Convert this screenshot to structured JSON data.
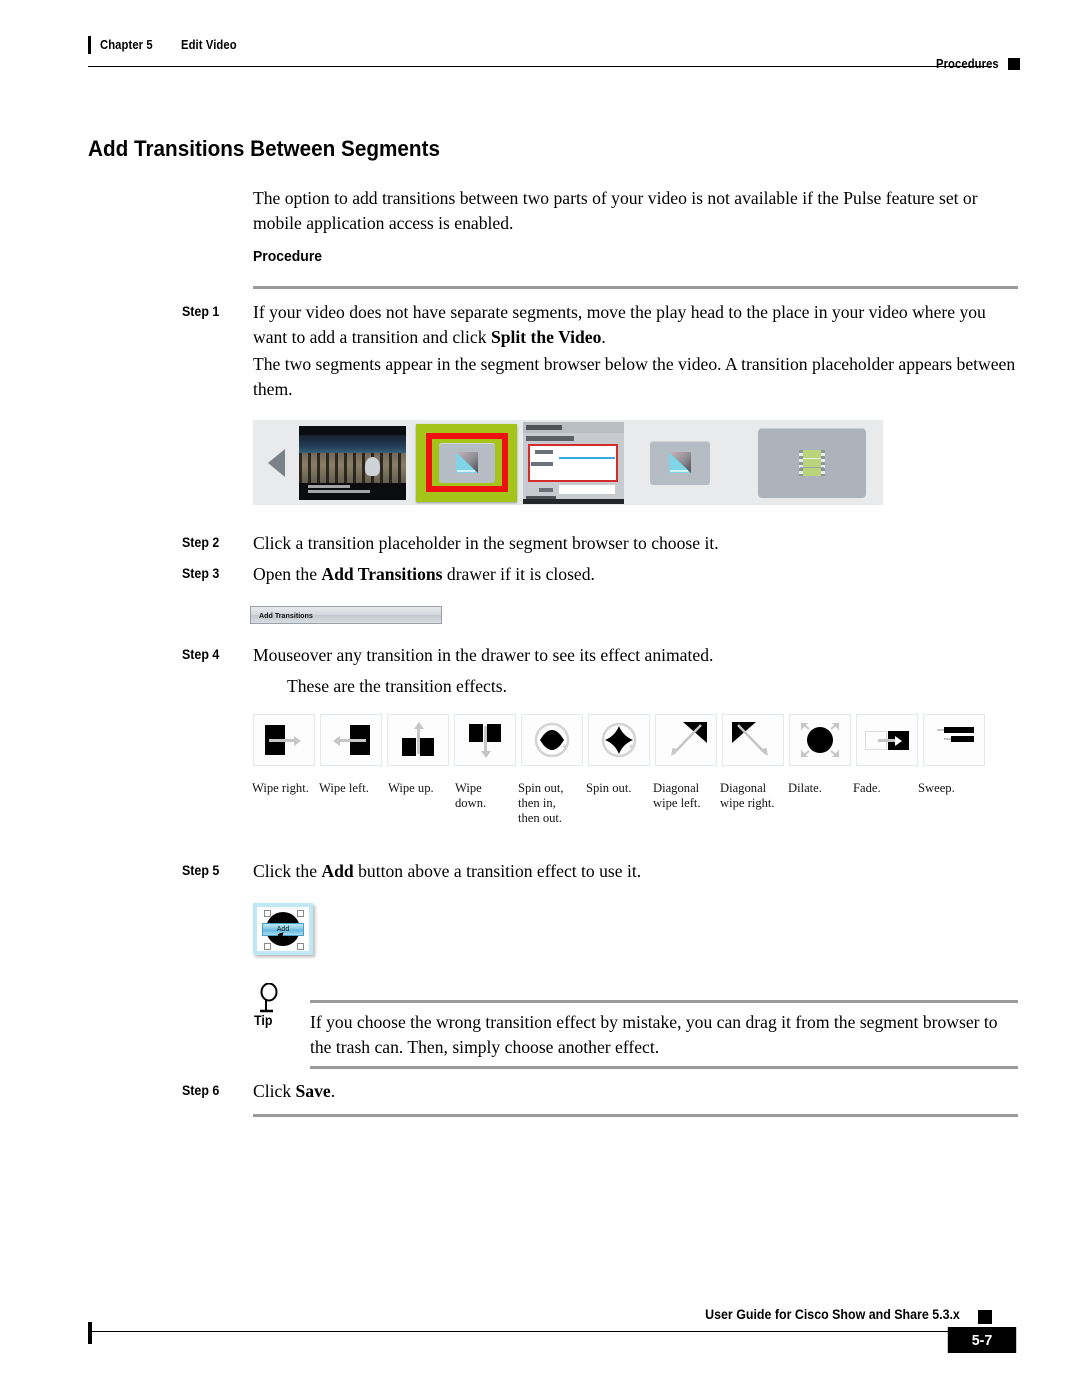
{
  "header": {
    "chapter": "Chapter 5",
    "section": "Edit Video",
    "right_label": "Procedures"
  },
  "title": "Add Transitions Between Segments",
  "intro": "The option to add transitions between two parts of your video is not available if the Pulse feature set or mobile application access is enabled.",
  "procedure_heading": "Procedure",
  "steps": {
    "step1": {
      "label": "Step 1",
      "text_a": "If your video does not have separate segments, move the play head to the place in your video where you want to add a transition and click ",
      "bold_a": "Split the Video",
      "text_b": ".",
      "result": "The two segments appear in the segment browser below the video. A transition placeholder appears between them."
    },
    "step2": {
      "label": "Step 2",
      "text": "Click a transition placeholder in the segment browser to choose it."
    },
    "step3": {
      "label": "Step 3",
      "text_a": "Open the ",
      "bold_a": "Add Transitions",
      "text_b": " drawer if it is closed."
    },
    "step4": {
      "label": "Step 4",
      "text": "Mouseover any transition in the drawer to see its effect animated.",
      "sub": "These are the transition effects."
    },
    "step5": {
      "label": "Step 5",
      "text_a": "Click the ",
      "bold_a": "Add",
      "text_b": " button above a transition effect to use it."
    },
    "step6": {
      "label": "Step 6",
      "text_a": "Click ",
      "bold_a": "Save",
      "text_b": "."
    }
  },
  "drawer_button": {
    "label": "Add Transitions"
  },
  "add_button": {
    "label": "Add"
  },
  "transition_effects": [
    {
      "name": "wipe-right",
      "label": "Wipe right."
    },
    {
      "name": "wipe-left",
      "label": "Wipe left."
    },
    {
      "name": "wipe-up",
      "label": "Wipe up."
    },
    {
      "name": "wipe-down",
      "label": "Wipe\ndown."
    },
    {
      "name": "spin-out-then-in-then-out",
      "label": "Spin out,\nthen in,\nthen out."
    },
    {
      "name": "spin-out",
      "label": "Spin out."
    },
    {
      "name": "diagonal-wipe-left",
      "label": "Diagonal\nwipe left."
    },
    {
      "name": "diagonal-wipe-right",
      "label": "Diagonal\nwipe right."
    },
    {
      "name": "dilate",
      "label": "Dilate."
    },
    {
      "name": "fade",
      "label": "Fade."
    },
    {
      "name": "sweep",
      "label": "Sweep."
    }
  ],
  "tip": {
    "label": "Tip",
    "text": "If you choose the wrong transition effect by mistake, you can drag it from the segment browser to the trash can. Then, simply choose another effect."
  },
  "footer": {
    "guide": "User Guide for Cisco Show and Share 5.3.x",
    "page": "5-7"
  },
  "colors": {
    "selection_green": "#a4c41a",
    "selection_red": "#ee1111",
    "rule_gray": "#9b9b9b",
    "panel_gray": "#e8eaec"
  }
}
